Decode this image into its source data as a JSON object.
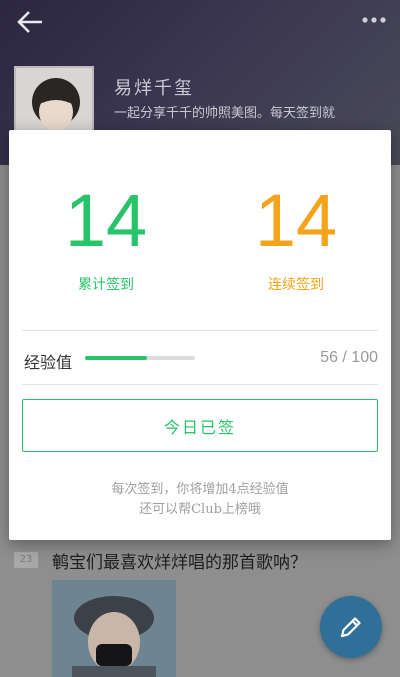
{
  "header": {
    "club_name": "易烊千玺",
    "description": "一起分享千千的帅照美图。每天签到就"
  },
  "post": {
    "badge": "23",
    "title": "鹌宝们最喜欢烊烊唱的那首歌呐？"
  },
  "dialog": {
    "total_checkins": {
      "value": "14",
      "label": "累计签到"
    },
    "streak_checkins": {
      "value": "14",
      "label": "连续签到"
    },
    "experience": {
      "label": "经验值",
      "value_text": "56 / 100",
      "fraction": 0.56
    },
    "signed_button_label": "今日已签",
    "hint_line1": "每次签到，你将增加4点经验值",
    "hint_line2": "还可以帮Club上榜哦"
  },
  "colors": {
    "accent_green": "#28c46a",
    "accent_orange": "#f5a21c",
    "fab_blue": "#2f6f98"
  },
  "icons": {
    "back": "arrow-left-icon",
    "more": "more-vertical-dots-icon",
    "fab": "pencil-icon"
  }
}
